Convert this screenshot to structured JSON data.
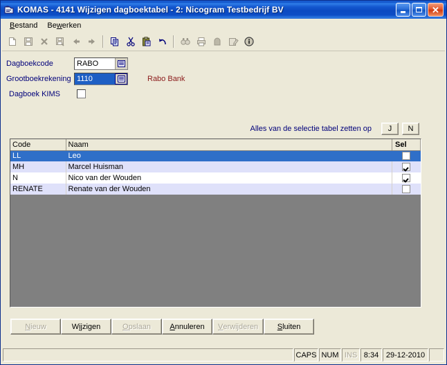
{
  "window": {
    "title": "KOMAS - 4141 Wijzigen dagboektabel - 2: Nicogram Testbedrijf BV",
    "icon": "application-icon",
    "caption_buttons": {
      "minimize": "minimize-button",
      "maximize": "maximize-button",
      "close_glyph": "✕"
    },
    "accent_title_color": "#0b49c1",
    "face_color": "#ece9d8"
  },
  "menubar": {
    "items": [
      {
        "pre": "",
        "accel": "B",
        "post": "estand"
      },
      {
        "pre": "Be",
        "accel": "w",
        "post": "erken"
      }
    ]
  },
  "toolbar": {
    "groups": [
      [
        {
          "name": "new-document-icon",
          "enabled": false
        },
        {
          "name": "save-icon",
          "enabled": false
        },
        {
          "name": "delete-icon",
          "enabled": false
        },
        {
          "name": "save-as-icon",
          "enabled": false
        },
        {
          "name": "back-arrow-icon",
          "enabled": false
        },
        {
          "name": "forward-arrow-icon",
          "enabled": false
        }
      ],
      [
        {
          "name": "copy-icon",
          "enabled": true
        },
        {
          "name": "cut-icon",
          "enabled": true
        },
        {
          "name": "paste-icon",
          "enabled": true
        },
        {
          "name": "undo-icon",
          "enabled": true
        }
      ],
      [
        {
          "name": "find-icon",
          "enabled": false
        },
        {
          "name": "print-icon",
          "enabled": false
        },
        {
          "name": "report-icon",
          "enabled": false
        },
        {
          "name": "edit-note-icon",
          "enabled": false
        },
        {
          "name": "info-icon",
          "enabled": true
        }
      ]
    ]
  },
  "form": {
    "dagboekcode": {
      "label": "Dagboekcode",
      "value": "RABO"
    },
    "grootboekrekening": {
      "label": "Grootboekrekening",
      "value": "1110",
      "note": "Rabo Bank"
    },
    "dagboek_kims": {
      "label": "Dagboek KIMS",
      "checked": false
    },
    "label_color": "#00007a",
    "note_color": "#8b1a1a"
  },
  "select_all": {
    "label": "Alles van de selectie tabel zetten op",
    "yes_label": "J",
    "no_label": "N"
  },
  "grid": {
    "columns": [
      "Code",
      "Naam",
      "Sel"
    ],
    "rows": [
      {
        "code": "LL",
        "naam": "Leo",
        "sel": false,
        "selected": true
      },
      {
        "code": "MH",
        "naam": "Marcel Huisman",
        "sel": true,
        "selected": false
      },
      {
        "code": "N",
        "naam": "Nico van der Wouden",
        "sel": true,
        "selected": false
      },
      {
        "code": "RENATE",
        "naam": "Renate van der Wouden",
        "sel": false,
        "selected": false
      }
    ],
    "empty_area_color": "#808080",
    "selection_color": "#2f6fc8"
  },
  "buttons": [
    {
      "pre": "",
      "accel": "N",
      "post": "ieuw",
      "enabled": false,
      "name": "nieuw-button"
    },
    {
      "pre": "W",
      "accel": "ij",
      "post": "zigen",
      "enabled": true,
      "name": "wijzigen-button"
    },
    {
      "pre": "",
      "accel": "O",
      "post": "pslaan",
      "enabled": false,
      "name": "opslaan-button"
    },
    {
      "pre": "",
      "accel": "A",
      "post": "nnuleren",
      "enabled": true,
      "name": "annuleren-button"
    },
    {
      "pre": "",
      "accel": "V",
      "post": "erwijderen",
      "enabled": false,
      "name": "verwijderen-button"
    },
    {
      "pre": "",
      "accel": "S",
      "post": "luiten",
      "enabled": true,
      "name": "sluiten-button"
    }
  ],
  "statusbar": {
    "message": "",
    "caps": "CAPS",
    "num": "NUM",
    "ins": "INS",
    "ins_active": false,
    "time": "8:34",
    "date": "29-12-2010"
  }
}
